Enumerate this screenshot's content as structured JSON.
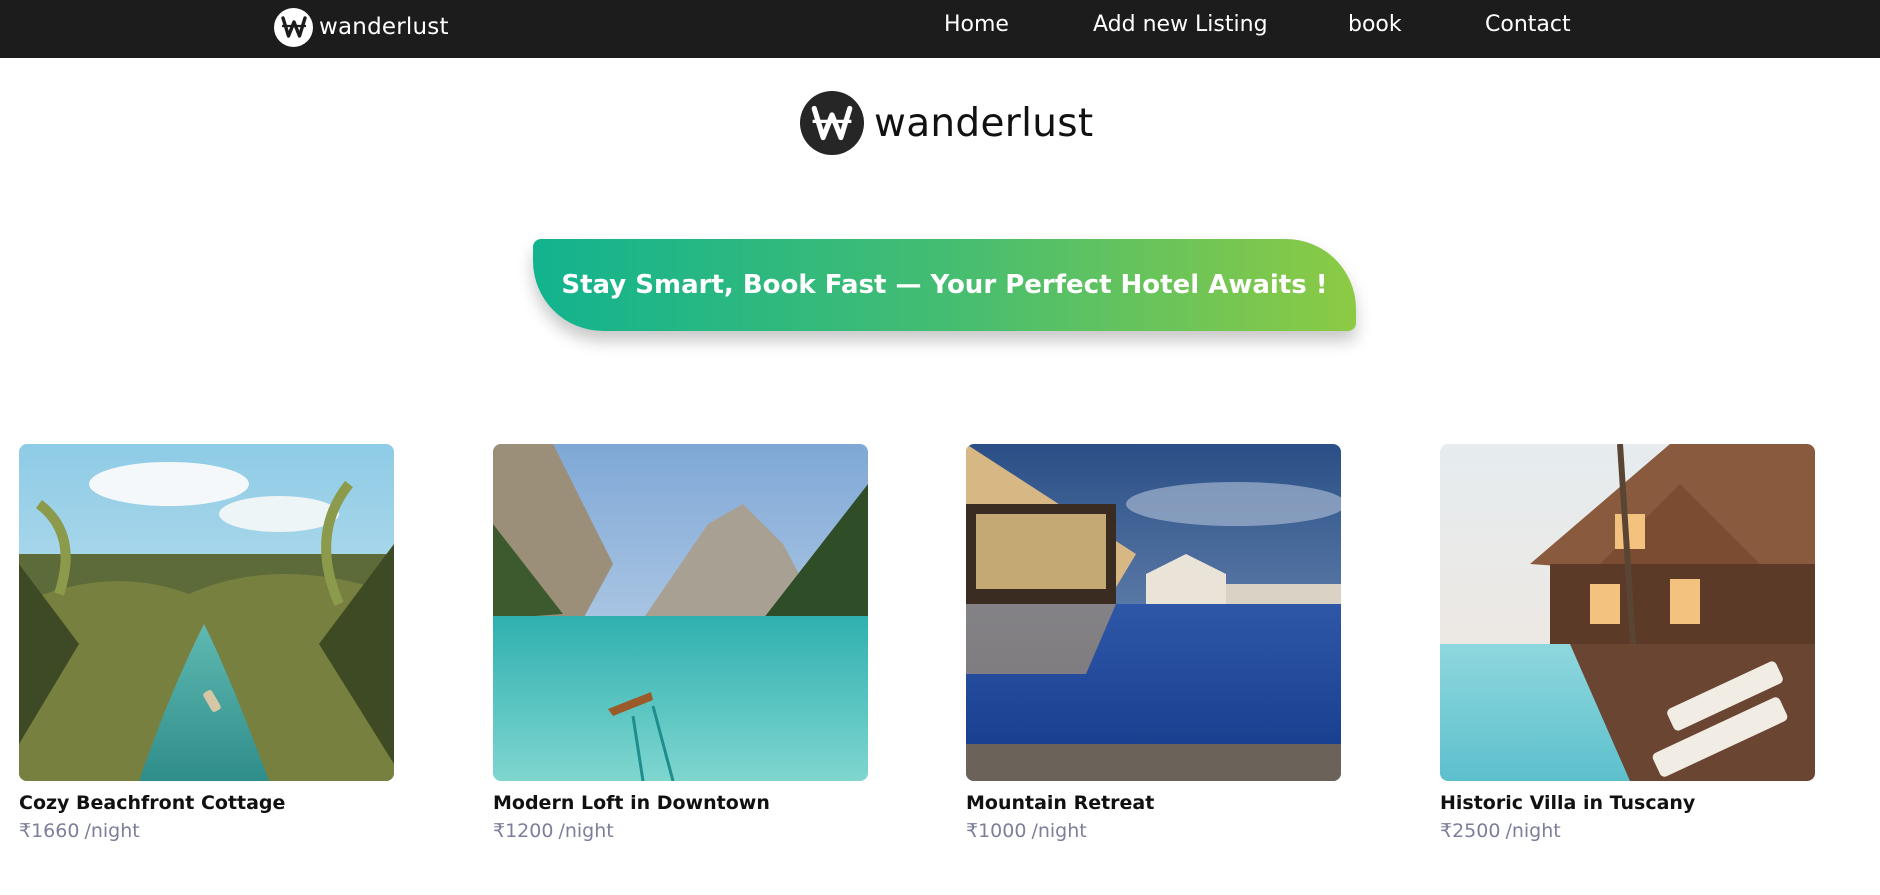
{
  "navbar": {
    "brand": "wanderlust",
    "logo_icon": "wanderlust-w-logo-icon",
    "links": [
      {
        "label": "Home"
      },
      {
        "label": "Add new Listing"
      },
      {
        "label": "book"
      },
      {
        "label": "Contact"
      }
    ]
  },
  "hero": {
    "brand": "wanderlust",
    "logo_icon": "wanderlust-w-logo-icon",
    "tagline": "Stay Smart, Book Fast — Your Perfect Hotel Awaits !"
  },
  "colors": {
    "navbar_bg": "#1c1c1c",
    "tagline_gradient_start": "#12b38f",
    "tagline_gradient_end": "#8cca44",
    "price_text": "#7d7f9a"
  },
  "listings": [
    {
      "title": "Cozy Beachfront Cottage",
      "price": "₹1660",
      "unit": "/night",
      "image": "tropical-river-palms-photo"
    },
    {
      "title": "Modern Loft in Downtown",
      "price": "₹1200",
      "unit": "/night",
      "image": "mountain-lake-boat-photo"
    },
    {
      "title": "Mountain Retreat",
      "price": "₹1000",
      "unit": "/night",
      "image": "resort-pool-night-photo"
    },
    {
      "title": "Historic Villa in Tuscany",
      "price": "₹2500",
      "unit": "/night",
      "image": "wooden-villa-pool-photo"
    }
  ]
}
